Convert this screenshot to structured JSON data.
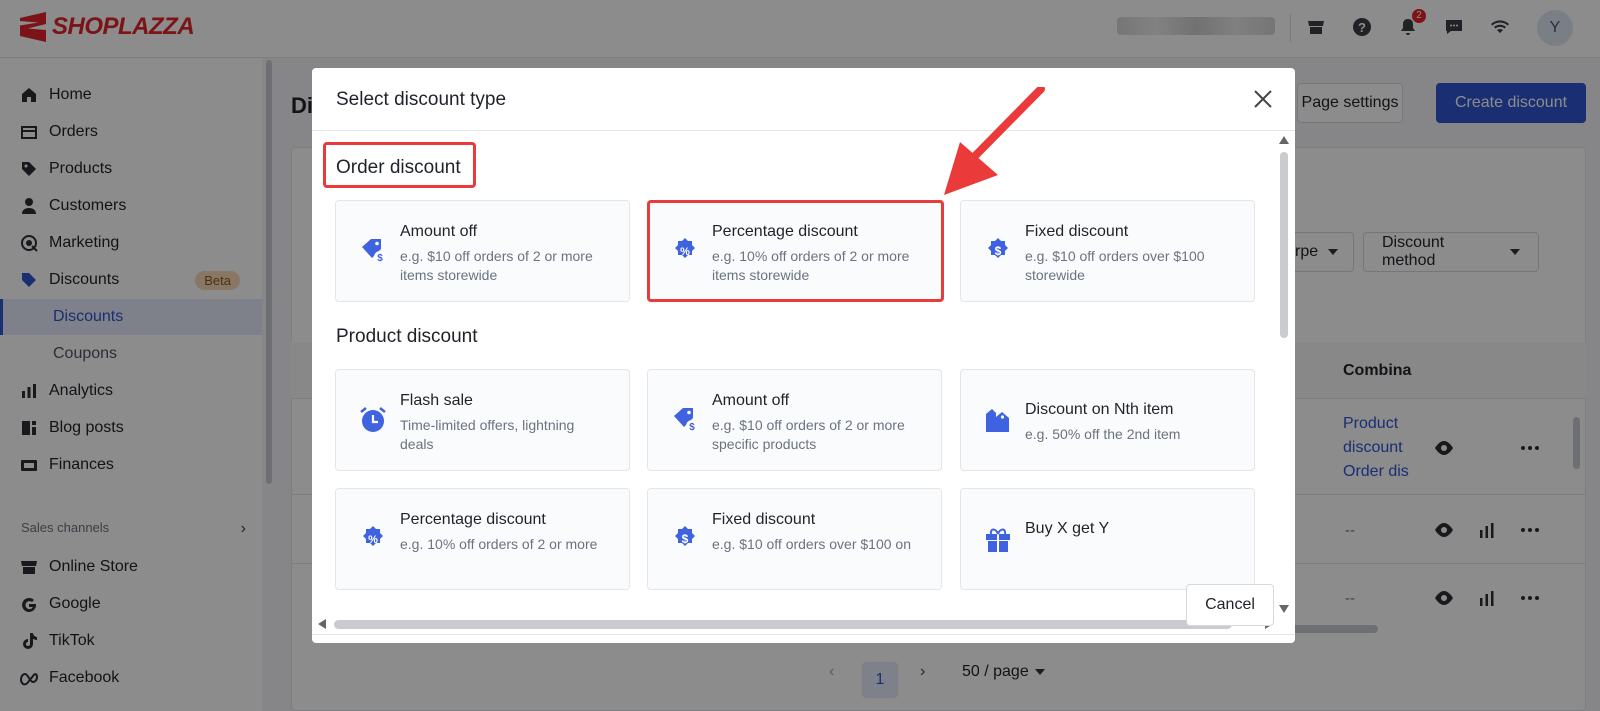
{
  "app": {
    "logo_text": "SHOPLAZZA"
  },
  "topbar": {
    "notification_count": "2",
    "avatar_initial": "Y"
  },
  "sidebar": {
    "items": [
      {
        "label": "Home",
        "icon": "home-icon"
      },
      {
        "label": "Orders",
        "icon": "orders-icon"
      },
      {
        "label": "Products",
        "icon": "tag-icon"
      },
      {
        "label": "Customers",
        "icon": "user-icon"
      },
      {
        "label": "Marketing",
        "icon": "marketing-icon"
      },
      {
        "label": "Discounts",
        "icon": "discount-icon",
        "badge": "Beta"
      },
      {
        "label": "Analytics",
        "icon": "analytics-icon"
      },
      {
        "label": "Blog posts",
        "icon": "blog-icon"
      },
      {
        "label": "Finances",
        "icon": "finances-icon"
      }
    ],
    "sub_items": [
      {
        "label": "Discounts",
        "active": true
      },
      {
        "label": "Coupons",
        "active": false
      }
    ],
    "sales_channels_label": "Sales channels",
    "channels": [
      {
        "label": "Online Store",
        "icon": "store-icon"
      },
      {
        "label": "Google",
        "icon": "google-icon"
      },
      {
        "label": "TikTok",
        "icon": "tiktok-icon"
      },
      {
        "label": "Facebook",
        "icon": "meta-icon"
      }
    ]
  },
  "main": {
    "title_fragment": "Di",
    "page_settings_label": "Page settings",
    "create_discount_label": "Create discount",
    "filter_type_fragment": "rpe",
    "filter_method_label": "Discount method",
    "column_header_fragment": "Combina",
    "row1_links": [
      "Product",
      "discount",
      "Order dis"
    ],
    "empty_value": "--",
    "pagination": {
      "current_page": "1",
      "page_size_label": "50 / page"
    }
  },
  "modal": {
    "title": "Select discount type",
    "sections": [
      {
        "title": "Order discount",
        "cards": [
          {
            "title": "Amount off",
            "desc": "e.g. $10 off orders of 2 or more items storewide",
            "icon": "tag-dollar-icon"
          },
          {
            "title": "Percentage discount",
            "desc": "e.g. 10% off orders of 2 or more items storewide",
            "icon": "percent-badge-icon"
          },
          {
            "title": "Fixed discount",
            "desc": "e.g. $10 off orders over $100 storewide",
            "icon": "dollar-badge-icon"
          }
        ]
      },
      {
        "title": "Product discount",
        "cards": [
          {
            "title": "Flash sale",
            "desc": "Time-limited offers, lightning deals",
            "icon": "alarm-clock-icon"
          },
          {
            "title": "Amount off",
            "desc": "e.g. $10 off orders of 2 or more specific products",
            "icon": "tag-dollar-icon"
          },
          {
            "title": "Discount on Nth item",
            "desc": "e.g. 50% off the 2nd item",
            "icon": "bags-icon"
          },
          {
            "title": "Percentage discount",
            "desc": "e.g. 10% off orders of 2 or more",
            "icon": "percent-badge-icon"
          },
          {
            "title": "Fixed discount",
            "desc": "e.g. $10 off orders over $100 on",
            "icon": "dollar-badge-icon"
          },
          {
            "title": "Buy X get Y",
            "desc": "",
            "icon": "gift-icon"
          }
        ]
      }
    ],
    "cancel_label": "Cancel"
  },
  "colors": {
    "brand": "#e0242b",
    "accent": "#2f54d1",
    "highlight": "#ea3a3a"
  }
}
